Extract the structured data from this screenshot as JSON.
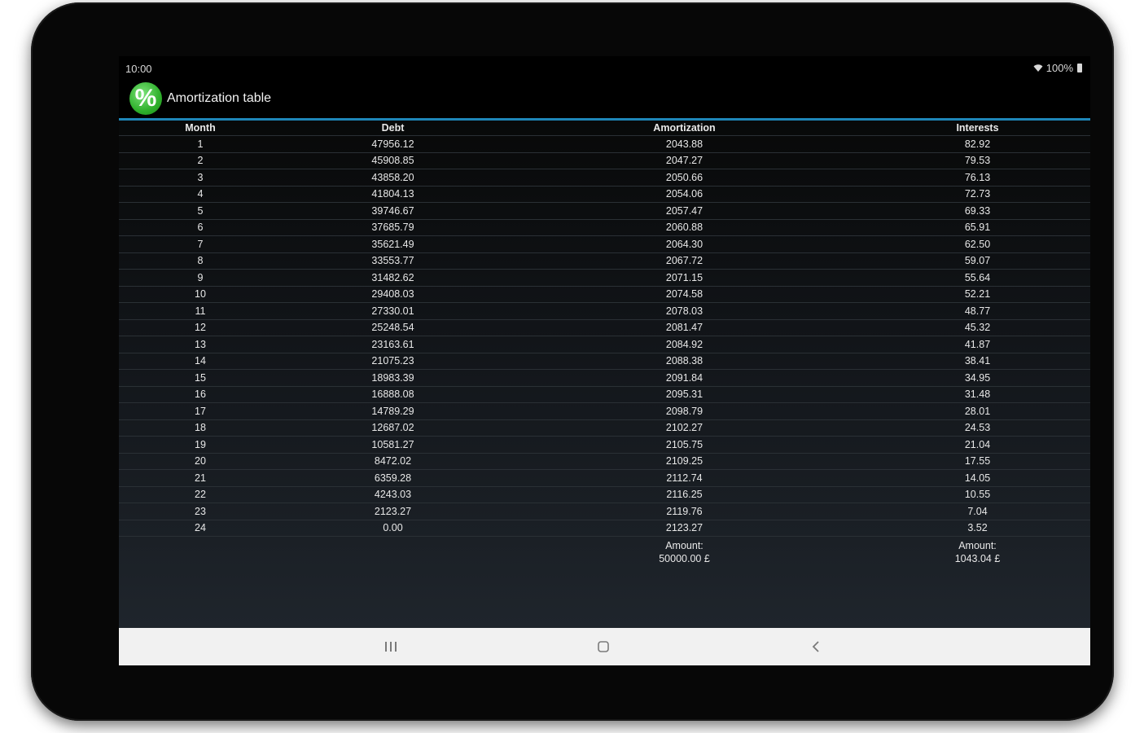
{
  "status_bar": {
    "time": "10:00",
    "battery": "100%"
  },
  "app": {
    "logo_symbol": "%",
    "title": "Amortization table",
    "accent_color": "#1e86b8",
    "logo_color": "#2fb02c"
  },
  "table": {
    "headers": [
      "Month",
      "Debt",
      "Amortization",
      "Interests"
    ],
    "rows": [
      [
        "1",
        "47956.12",
        "2043.88",
        "82.92"
      ],
      [
        "2",
        "45908.85",
        "2047.27",
        "79.53"
      ],
      [
        "3",
        "43858.20",
        "2050.66",
        "76.13"
      ],
      [
        "4",
        "41804.13",
        "2054.06",
        "72.73"
      ],
      [
        "5",
        "39746.67",
        "2057.47",
        "69.33"
      ],
      [
        "6",
        "37685.79",
        "2060.88",
        "65.91"
      ],
      [
        "7",
        "35621.49",
        "2064.30",
        "62.50"
      ],
      [
        "8",
        "33553.77",
        "2067.72",
        "59.07"
      ],
      [
        "9",
        "31482.62",
        "2071.15",
        "55.64"
      ],
      [
        "10",
        "29408.03",
        "2074.58",
        "52.21"
      ],
      [
        "11",
        "27330.01",
        "2078.03",
        "48.77"
      ],
      [
        "12",
        "25248.54",
        "2081.47",
        "45.32"
      ],
      [
        "13",
        "23163.61",
        "2084.92",
        "41.87"
      ],
      [
        "14",
        "21075.23",
        "2088.38",
        "38.41"
      ],
      [
        "15",
        "18983.39",
        "2091.84",
        "34.95"
      ],
      [
        "16",
        "16888.08",
        "2095.31",
        "31.48"
      ],
      [
        "17",
        "14789.29",
        "2098.79",
        "28.01"
      ],
      [
        "18",
        "12687.02",
        "2102.27",
        "24.53"
      ],
      [
        "19",
        "10581.27",
        "2105.75",
        "21.04"
      ],
      [
        "20",
        "8472.02",
        "2109.25",
        "17.55"
      ],
      [
        "21",
        "6359.28",
        "2112.74",
        "14.05"
      ],
      [
        "22",
        "4243.03",
        "2116.25",
        "10.55"
      ],
      [
        "23",
        "2123.27",
        "2119.76",
        "7.04"
      ],
      [
        "24",
        "0.00",
        "2123.27",
        "3.52"
      ]
    ],
    "totals": {
      "amortization_label": "Amount:",
      "amortization_value": "50000.00 £",
      "interests_label": "Amount:",
      "interests_value": "1043.04 £"
    }
  },
  "nav_bar": {
    "recents_icon": "recents-icon",
    "home_icon": "home-icon",
    "back_icon": "back-icon"
  }
}
